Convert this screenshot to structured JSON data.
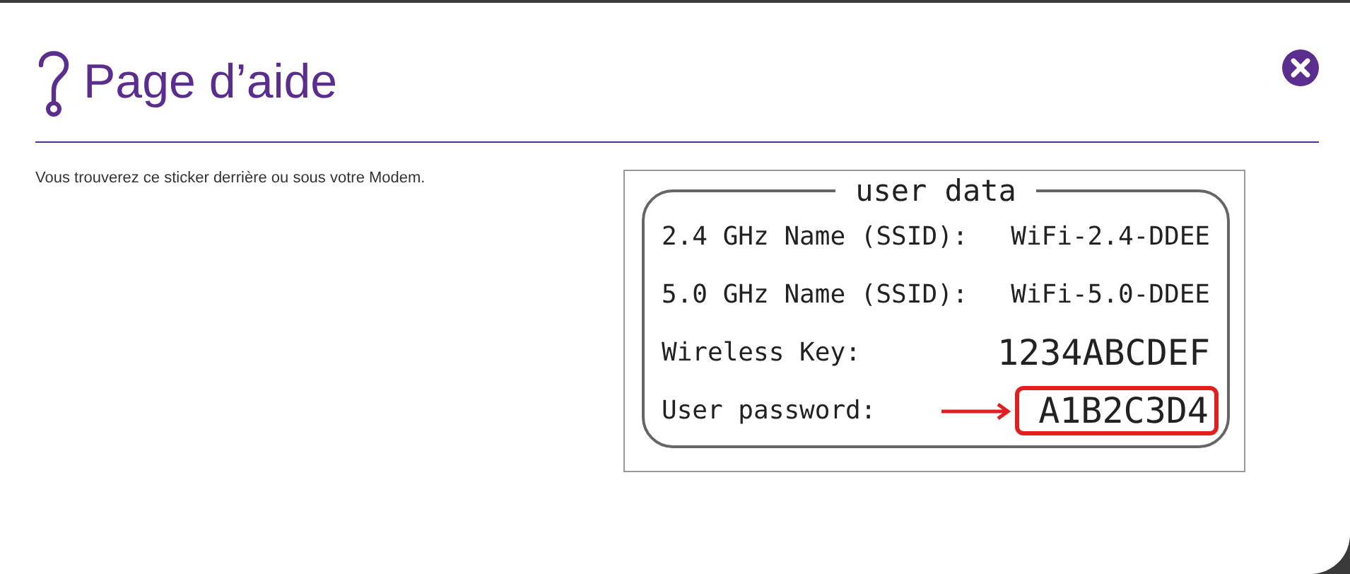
{
  "dialog": {
    "title": "Page d’aide",
    "intro": "Vous trouverez ce sticker derrière ou sous votre Modem."
  },
  "sticker": {
    "legend": "user data",
    "rows": [
      {
        "label": "2.4 GHz Name (SSID):",
        "value": "WiFi-2.4-DDEE",
        "kind": "plain",
        "highlighted": false
      },
      {
        "label": "5.0 GHz Name (SSID):",
        "value": "WiFi-5.0-DDEE",
        "kind": "plain",
        "highlighted": false
      },
      {
        "label": "Wireless Key:",
        "value": "1234ABCDEF",
        "kind": "large",
        "highlighted": false
      },
      {
        "label": "User password:",
        "value": "A1B2C3D4",
        "kind": "large",
        "highlighted": true
      }
    ]
  }
}
